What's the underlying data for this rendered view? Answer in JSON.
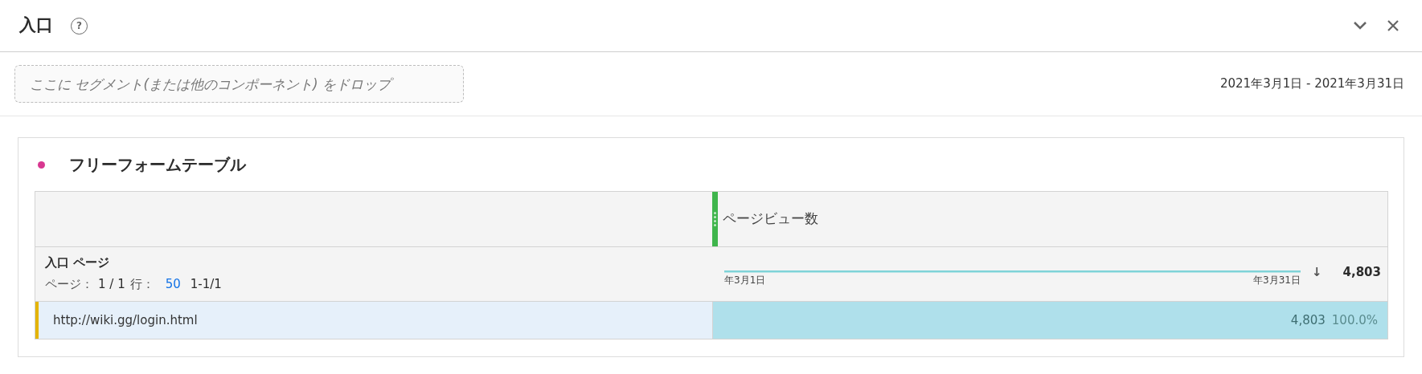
{
  "panel": {
    "title": "入口",
    "help": "?"
  },
  "segment_drop": {
    "placeholder": "ここに セグメント(または他のコンポーネント) をドロップ"
  },
  "date_range": "2021年3月1日 - 2021年3月31日",
  "freeform": {
    "title": "フリーフォームテーブル",
    "color": "#d83790",
    "metric_column": "ページビュー数",
    "dimension": "入口 ページ",
    "pager": {
      "page_label": "ページ：",
      "page": "1 / 1",
      "rows_label": "行：",
      "rows": "50",
      "range": "1-1/1"
    },
    "sparkline_start": "年3月1日",
    "sparkline_end": "年3月31日",
    "sort_icon": "↓",
    "total": "4,803",
    "rows": [
      {
        "label": "http://wiki.gg/login.html",
        "value": "4,803",
        "percent": "100.0%",
        "level": 1.0
      }
    ]
  }
}
